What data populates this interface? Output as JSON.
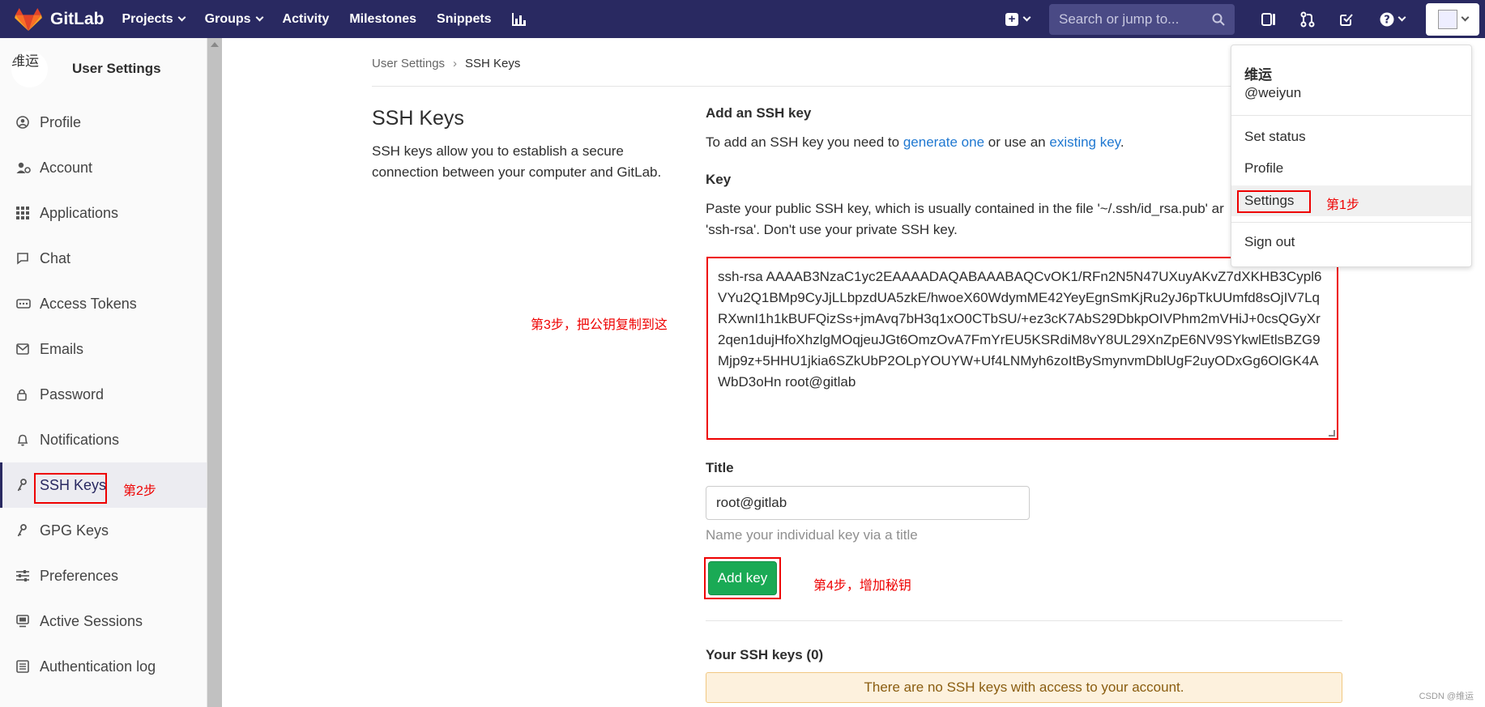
{
  "header": {
    "brand": "GitLab",
    "nav": [
      {
        "label": "Projects",
        "dropdown": true
      },
      {
        "label": "Groups",
        "dropdown": true
      },
      {
        "label": "Activity",
        "dropdown": false
      },
      {
        "label": "Milestones",
        "dropdown": false
      },
      {
        "label": "Snippets",
        "dropdown": false
      }
    ],
    "search_placeholder": "Search or jump to...",
    "colors": {
      "navbar": "#292961",
      "search_bg": "#4a4a85"
    }
  },
  "sidebar": {
    "avatar_text": "维运",
    "title": "User Settings",
    "items": [
      {
        "label": "Profile",
        "icon": "profile-icon"
      },
      {
        "label": "Account",
        "icon": "account-icon"
      },
      {
        "label": "Applications",
        "icon": "applications-icon"
      },
      {
        "label": "Chat",
        "icon": "chat-icon"
      },
      {
        "label": "Access Tokens",
        "icon": "access-tokens-icon"
      },
      {
        "label": "Emails",
        "icon": "emails-icon"
      },
      {
        "label": "Password",
        "icon": "lock-icon"
      },
      {
        "label": "Notifications",
        "icon": "bell-icon"
      },
      {
        "label": "SSH Keys",
        "icon": "key-icon",
        "active": true
      },
      {
        "label": "GPG Keys",
        "icon": "key-icon"
      },
      {
        "label": "Preferences",
        "icon": "sliders-icon"
      },
      {
        "label": "Active Sessions",
        "icon": "monitor-icon"
      },
      {
        "label": "Authentication log",
        "icon": "list-icon"
      }
    ]
  },
  "breadcrumb": {
    "parent": "User Settings",
    "current": "SSH Keys"
  },
  "page": {
    "title": "SSH Keys",
    "description": "SSH keys allow you to establish a secure connection between your computer and GitLab."
  },
  "form": {
    "add_heading": "Add an SSH key",
    "intro_prefix": "To add an SSH key you need to ",
    "generate_link": "generate one",
    "intro_middle": " or use an ",
    "existing_link": "existing key",
    "intro_suffix": ".",
    "key_label": "Key",
    "key_help_line1": "Paste your public SSH key, which is usually contained in the file '~/.ssh/id_rsa.pub' ar",
    "key_help_line2": "'ssh-rsa'. Don't use your private SSH key.",
    "key_value": "ssh-rsa AAAAB3NzaC1yc2EAAAADAQABAAABAQCvOK1/RFn2N5N47UXuyAKvZ7dXKHB3Cypl6VYu2Q1BMp9CyJjLLbpzdUA5zkE/hwoeX60WdymME42YeyEgnSmKjRu2yJ6pTkUUmfd8sOjIV7LqRXwnI1h1kBUFQizSs+jmAvq7bH3q1xO0CTbSU/+ez3cK7AbS29DbkpOIVPhm2mVHiJ+0csQGyXr2qen1dujHfoXhzlgMOqjeuJGt6OmzOvA7FmYrEU5KSRdiM8vY8UL29XnZpE6NV9SYkwlEtlsBZG9Mjp9z+5HHU1jkia6SZkUbP2OLpYOUYW+Uf4LNMyh6zoItBySmynvmDblUgF2uyODxGg6OlGK4AWbD3oHn root@gitlab",
    "title_label": "Title",
    "title_value": "root@gitlab",
    "title_help": "Name your individual key via a title",
    "submit_label": "Add key",
    "your_keys_heading": "Your SSH keys (0)",
    "empty_message": "There are no SSH keys with access to your account."
  },
  "annotations": {
    "step1": "第1步",
    "step2": "第2步",
    "step3": "第3步，把公钥复制到这",
    "step4": "第4步，增加秘钥"
  },
  "user_menu": {
    "name": "维运",
    "username": "@weiyun",
    "items": [
      "Set status",
      "Profile",
      "Settings",
      "Sign out"
    ]
  },
  "watermark": "CSDN @维运"
}
